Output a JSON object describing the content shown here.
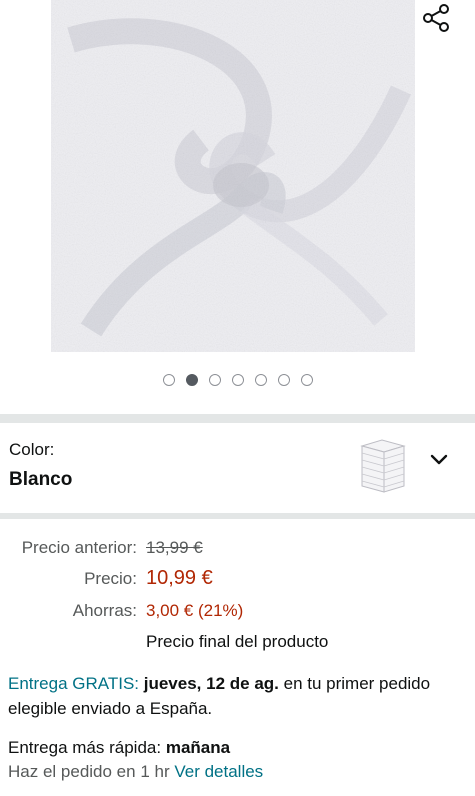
{
  "gallery": {
    "image_alt": "towel",
    "dots_total": 7,
    "active_dot_index": 1
  },
  "color": {
    "label": "Color:",
    "value": "Blanco"
  },
  "pricing": {
    "previous_label": "Precio anterior:",
    "previous_value": "13,99 €",
    "price_label": "Precio:",
    "price_value": "10,99 €",
    "savings_label": "Ahorras:",
    "savings_value": "3,00 € (21%)",
    "final_note": "Precio final del producto"
  },
  "delivery": {
    "free_link": "Entrega GRATIS:",
    "date": "jueves, 12 de ag.",
    "rest": " en tu primer pedido elegible enviado a España."
  },
  "fast_delivery": {
    "label": "Entrega más rápida:",
    "when": "mañana",
    "order_within": "Haz el pedido en 1 hr",
    "details_link": "Ver detalles"
  },
  "colors": {
    "link": "#007185",
    "price_red": "#b12704",
    "divider": "#e3e6e6"
  }
}
